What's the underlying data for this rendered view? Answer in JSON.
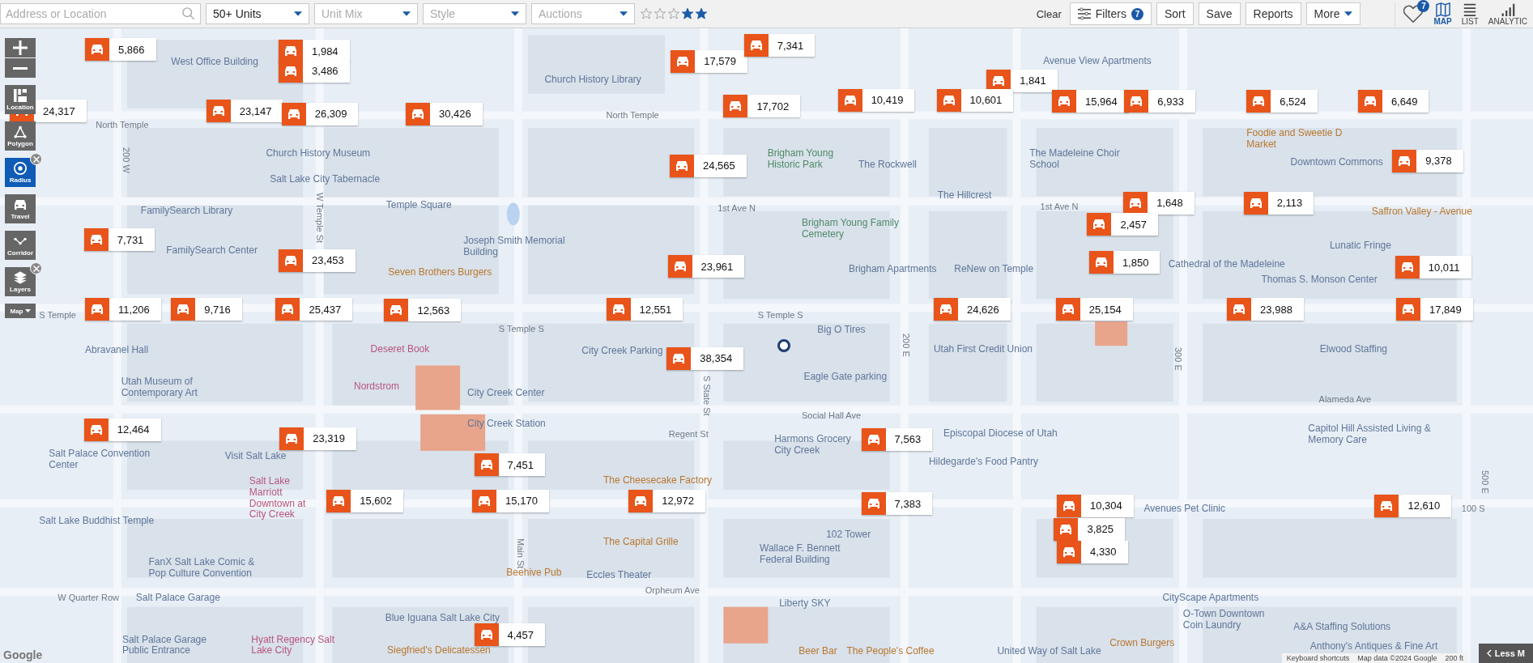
{
  "search": {
    "placeholder": "Address or Location"
  },
  "dropdowns": [
    {
      "label": "50+ Units",
      "has_value": true
    },
    {
      "label": "Unit Mix",
      "has_value": false
    },
    {
      "label": "Style",
      "has_value": false
    },
    {
      "label": "Auctions",
      "has_value": false
    }
  ],
  "stars": 2,
  "actions": [
    {
      "label": "Clear",
      "kind": "link"
    },
    {
      "label": "Filters",
      "kind": "filters",
      "badge": "7"
    },
    {
      "label": "Sort",
      "kind": "button"
    },
    {
      "label": "Save",
      "kind": "button"
    },
    {
      "label": "Reports",
      "kind": "button"
    },
    {
      "label": "More",
      "kind": "menu"
    }
  ],
  "favorites_badge": "7",
  "views": [
    {
      "label": "MAP",
      "selected": true
    },
    {
      "label": "LIST",
      "selected": false
    },
    {
      "label": "ANALYTIC",
      "selected": false
    }
  ],
  "tools": [
    {
      "label": "Location",
      "selected": false,
      "removable": false
    },
    {
      "label": "Polygon",
      "selected": false,
      "removable": false
    },
    {
      "label": "Radius",
      "selected": true,
      "removable": true
    },
    {
      "label": "Travel",
      "selected": false,
      "removable": false
    },
    {
      "label": "Corridor",
      "selected": false,
      "removable": false
    },
    {
      "label": "Layers",
      "selected": false,
      "removable": true
    },
    {
      "label": "Map",
      "selected": false,
      "removable": false
    }
  ],
  "markers": [
    "5,866",
    "1,984",
    "3,486",
    "17,579",
    "7,341",
    "1,841",
    "24,317",
    "23,147",
    "26,309",
    "30,426",
    "17,702",
    "10,419",
    "10,601",
    "15,964",
    "6,933",
    "6,524",
    "6,649",
    "24,565",
    "9,378",
    "1,648",
    "2,113",
    "7,731",
    "2,457",
    "23,453",
    "23,961",
    "1,850",
    "10,011",
    "11,206",
    "9,716",
    "25,437",
    "12,563",
    "12,551",
    "24,626",
    "25,154",
    "23,988",
    "17,849",
    "38,354",
    "12,464",
    "23,319",
    "7,563",
    "7,451",
    "15,602",
    "15,170",
    "12,972",
    "7,383",
    "10,304",
    "12,610",
    "3,825",
    "4,330",
    "4,457"
  ],
  "map_labels": [
    {
      "text": "West Office Building",
      "kind": "poi"
    },
    {
      "text": "Avenue View Apartments",
      "kind": "poi"
    },
    {
      "text": "Church History Library",
      "kind": "poi"
    },
    {
      "text": "North Temple",
      "kind": "street"
    },
    {
      "text": "North Temple",
      "kind": "street"
    },
    {
      "text": "200 W",
      "kind": "street_v"
    },
    {
      "text": "Foodie and Sweetie D Market",
      "kind": "food"
    },
    {
      "text": "Church History Museum",
      "kind": "poi"
    },
    {
      "text": "Brigham Young Historic Park",
      "kind": "park"
    },
    {
      "text": "The Rockwell",
      "kind": "poi"
    },
    {
      "text": "The Madeleine Choir School",
      "kind": "poi"
    },
    {
      "text": "Downtown Commons",
      "kind": "poi"
    },
    {
      "text": "Salt Lake City Tabernacle",
      "kind": "poi"
    },
    {
      "text": "The Hillcrest",
      "kind": "poi"
    },
    {
      "text": "FamilySearch Library",
      "kind": "poi"
    },
    {
      "text": "W Temple St",
      "kind": "street_v"
    },
    {
      "text": "Temple Square",
      "kind": "poi"
    },
    {
      "text": "1st Ave N",
      "kind": "street"
    },
    {
      "text": "1st Ave N",
      "kind": "street"
    },
    {
      "text": "Saffron Valley - Avenue",
      "kind": "food"
    },
    {
      "text": "Brigham Young Family Cemetery",
      "kind": "park"
    },
    {
      "text": "FamilySearch Center",
      "kind": "poi"
    },
    {
      "text": "Joseph Smith Memorial Building",
      "kind": "poi"
    },
    {
      "text": "Lunatic Fringe",
      "kind": "poi"
    },
    {
      "text": "Seven Brothers Burgers",
      "kind": "food"
    },
    {
      "text": "Brigham Apartments",
      "kind": "poi"
    },
    {
      "text": "ReNew on Temple",
      "kind": "poi"
    },
    {
      "text": "Cathedral of the Madeleine",
      "kind": "poi"
    },
    {
      "text": "Thomas S. Monson Center",
      "kind": "poi"
    },
    {
      "text": "S Temple",
      "kind": "street"
    },
    {
      "text": "S Temple S",
      "kind": "street"
    },
    {
      "text": "S Temple S",
      "kind": "street"
    },
    {
      "text": "Big O Tires",
      "kind": "poi"
    },
    {
      "text": "Abravanel Hall",
      "kind": "poi"
    },
    {
      "text": "Deseret Book",
      "kind": "hotel"
    },
    {
      "text": "City Creek Parking",
      "kind": "poi"
    },
    {
      "text": "200 E",
      "kind": "street_v"
    },
    {
      "text": "Utah First Credit Union",
      "kind": "poi"
    },
    {
      "text": "300 E",
      "kind": "street_v"
    },
    {
      "text": "Elwood Staffing",
      "kind": "poi"
    },
    {
      "text": "Utah Museum of Contemporary Art",
      "kind": "poi"
    },
    {
      "text": "Nordstrom",
      "kind": "hotel"
    },
    {
      "text": "City Creek Center",
      "kind": "poi"
    },
    {
      "text": "S State St",
      "kind": "street_v"
    },
    {
      "text": "Eagle Gate parking",
      "kind": "poi"
    },
    {
      "text": "Alameda Ave",
      "kind": "street"
    },
    {
      "text": "City Creek Station",
      "kind": "poi"
    },
    {
      "text": "Social Hall Ave",
      "kind": "street"
    },
    {
      "text": "Regent St",
      "kind": "street"
    },
    {
      "text": "Harmons Grocery City Creek",
      "kind": "poi"
    },
    {
      "text": "Episcopal Diocese of Utah",
      "kind": "poi"
    },
    {
      "text": "Capitol Hill Assisted Living & Memory Care",
      "kind": "poi"
    },
    {
      "text": "Salt Palace Convention Center",
      "kind": "poi"
    },
    {
      "text": "Visit Salt Lake",
      "kind": "poi"
    },
    {
      "text": "Hildegarde's Food Pantry",
      "kind": "poi"
    },
    {
      "text": "500 E",
      "kind": "street_v"
    },
    {
      "text": "Salt Lake Marriott Downtown at City Creek",
      "kind": "hotel"
    },
    {
      "text": "The Cheesecake Factory",
      "kind": "food"
    },
    {
      "text": "Avenues Pet Clinic",
      "kind": "poi"
    },
    {
      "text": "100 S",
      "kind": "street"
    },
    {
      "text": "Salt Lake Buddhist Temple",
      "kind": "poi"
    },
    {
      "text": "Main St",
      "kind": "street_v"
    },
    {
      "text": "The Capital Grille",
      "kind": "food"
    },
    {
      "text": "Wallace F. Bennett Federal Building",
      "kind": "poi"
    },
    {
      "text": "102 Tower",
      "kind": "poi"
    },
    {
      "text": "FanX Salt Lake Comic & Pop Culture Convention",
      "kind": "poi"
    },
    {
      "text": "Beehive Pub",
      "kind": "food"
    },
    {
      "text": "Eccles Theater",
      "kind": "poi"
    },
    {
      "text": "W Quarter Row",
      "kind": "street"
    },
    {
      "text": "Salt Palace Garage",
      "kind": "poi"
    },
    {
      "text": "Orpheum Ave",
      "kind": "street"
    },
    {
      "text": "Liberty SKY",
      "kind": "poi"
    },
    {
      "text": "CityScape Apartments",
      "kind": "poi"
    },
    {
      "text": "Blue Iguana Salt Lake City",
      "kind": "poi"
    },
    {
      "text": "O-Town Downtown Coin Laundry",
      "kind": "poi"
    },
    {
      "text": "A&A Staffing Solutions",
      "kind": "poi"
    },
    {
      "text": "Salt Palace Garage Public Entrance",
      "kind": "poi"
    },
    {
      "text": "Hyatt Regency Salt Lake City",
      "kind": "hotel"
    },
    {
      "text": "Siegfried's Delicatessen",
      "kind": "food"
    },
    {
      "text": "Beer Bar",
      "kind": "food"
    },
    {
      "text": "The People's Coffee",
      "kind": "food"
    },
    {
      "text": "United Way of Salt Lake",
      "kind": "poi"
    },
    {
      "text": "Crown Burgers",
      "kind": "food"
    },
    {
      "text": "Anthony's Antiques & Fine Art",
      "kind": "poi"
    }
  ],
  "logo": "Google",
  "attribution": [
    "Keyboard shortcuts",
    "Map data ©2024 Google",
    "200 ft"
  ],
  "less_button": "Less M"
}
